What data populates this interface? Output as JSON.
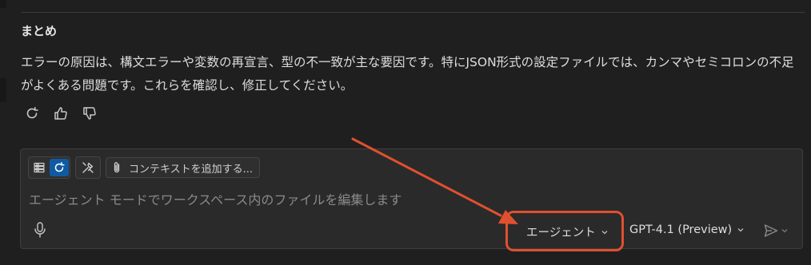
{
  "summary": {
    "heading": "まとめ",
    "body": "エラーの原因は、構文エラーや変数の再宣言、型の不一致が主な要因です。特にJSON形式の設定ファイルでは、カンマやセミコロンの不足がよくある問題です。これらを確認し、修正してください。"
  },
  "response_actions": {
    "icons": [
      "retry-icon",
      "thumbs-up-icon",
      "thumbs-down-icon"
    ]
  },
  "chat_input": {
    "add_context_label": "コンテキストを追加する...",
    "placeholder": "エージェント モードでワークスペース内のファイルを編集します",
    "mode_label": "エージェント",
    "model_label": "GPT-4.1 (Preview)"
  },
  "colors": {
    "background": "#1f1f1f",
    "input_background": "#2a2a2a",
    "active_accent": "#0f5aa3",
    "annotation": "#e0502f"
  }
}
